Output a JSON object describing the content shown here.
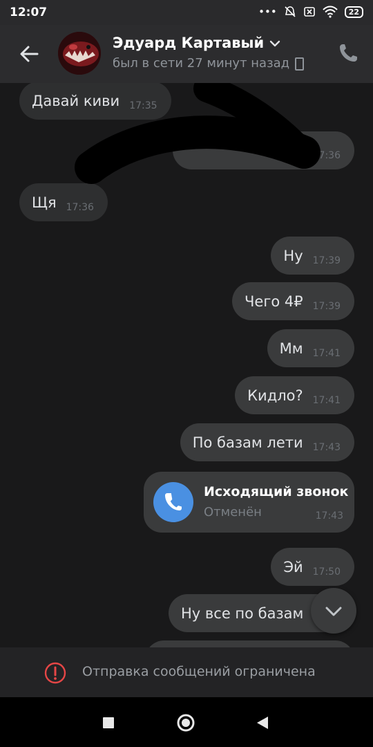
{
  "status_bar": {
    "time": "12:07",
    "battery": "22"
  },
  "header": {
    "contact_name": "Эдуард Картавый",
    "presence": "был в сети 27 минут назад"
  },
  "messages": [
    {
      "text": "Давай киви",
      "time": "17:35",
      "direction": "in"
    },
    {
      "text": "",
      "time": "17:36",
      "direction": "out"
    },
    {
      "text": "Щя",
      "time": "17:36",
      "direction": "in"
    },
    {
      "text": "Ну",
      "time": "17:39",
      "direction": "out"
    },
    {
      "text": "Чего 4₽",
      "time": "17:39",
      "direction": "out"
    },
    {
      "text": "Мм",
      "time": "17:41",
      "direction": "out"
    },
    {
      "text": "Кидло?",
      "time": "17:41",
      "direction": "out"
    },
    {
      "text": "По базам лети",
      "time": "17:43",
      "direction": "out"
    },
    {
      "text": "Эй",
      "time": "17:50",
      "direction": "out"
    },
    {
      "text": "Ну все по базам",
      "time": "",
      "direction": "out"
    }
  ],
  "call_card": {
    "title": "Исходящий звонок",
    "subtitle": "Отменён",
    "time": "17:43"
  },
  "restriction": {
    "text": "Отправка сообщений ограничена"
  },
  "colors": {
    "accent": "#4a90e2",
    "warning": "#e64646",
    "bubble_in": "#2e2f30",
    "bubble_out": "#3a3b3c"
  }
}
